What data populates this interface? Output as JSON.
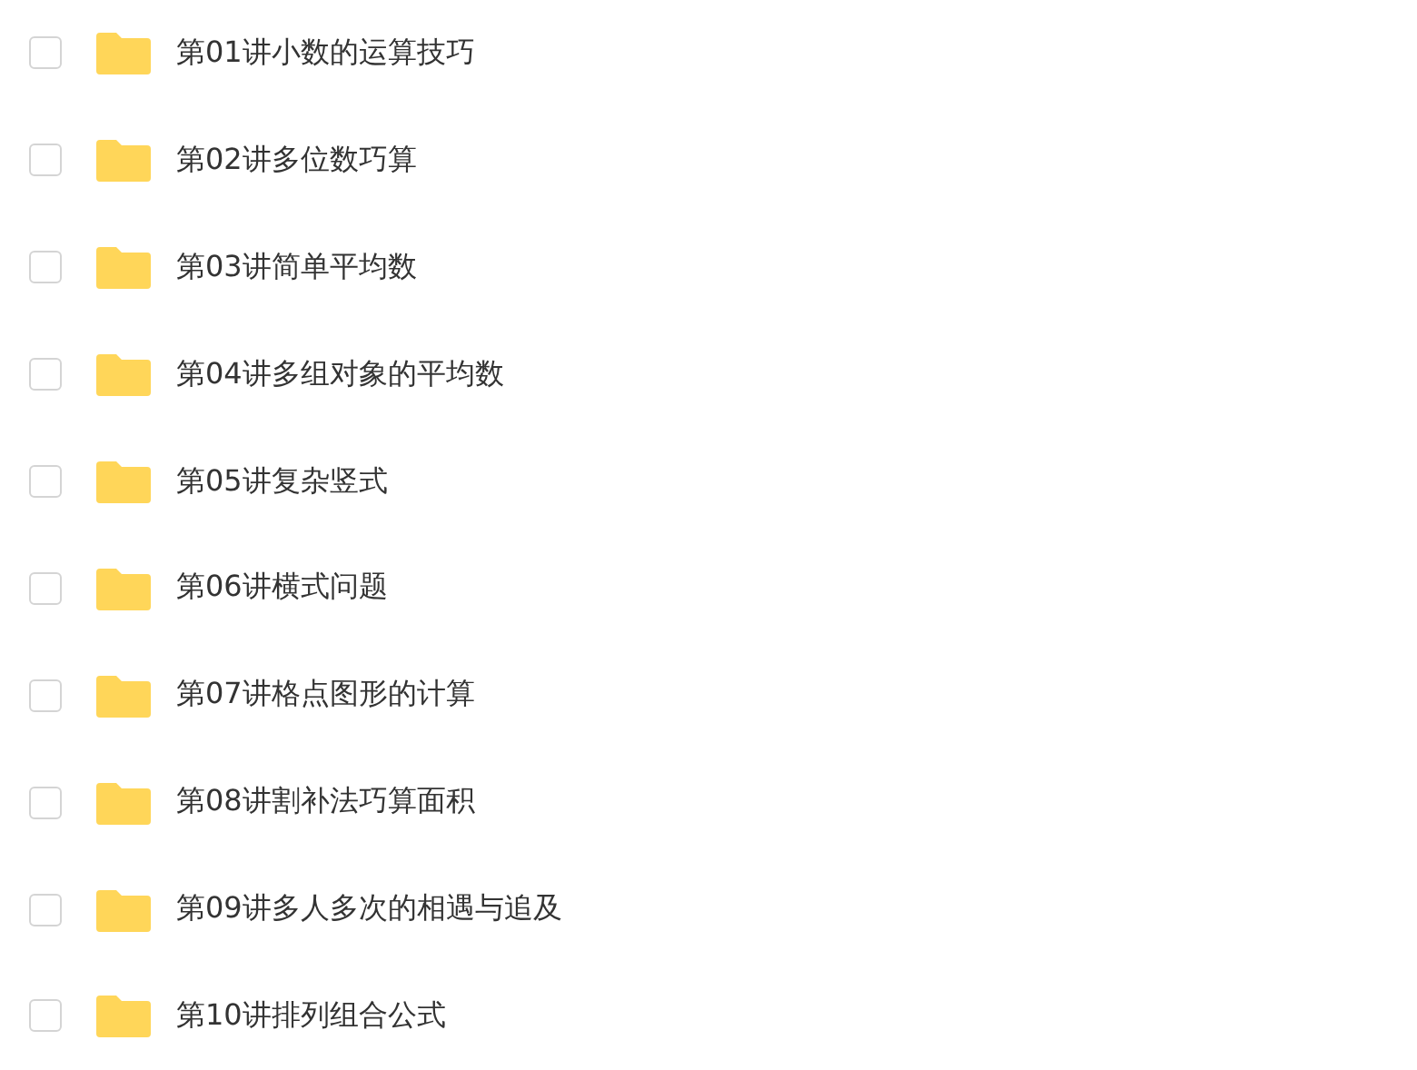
{
  "folders": [
    {
      "name": "第01讲小数的运算技巧",
      "checked": false
    },
    {
      "name": "第02讲多位数巧算",
      "checked": false
    },
    {
      "name": "第03讲简单平均数",
      "checked": false
    },
    {
      "name": "第04讲多组对象的平均数",
      "checked": false
    },
    {
      "name": "第05讲复杂竖式",
      "checked": false
    },
    {
      "name": "第06讲横式问题",
      "checked": false
    },
    {
      "name": "第07讲格点图形的计算",
      "checked": false
    },
    {
      "name": "第08讲割补法巧算面积",
      "checked": false
    },
    {
      "name": "第09讲多人多次的相遇与追及",
      "checked": false
    },
    {
      "name": "第10讲排列组合公式",
      "checked": false
    }
  ]
}
